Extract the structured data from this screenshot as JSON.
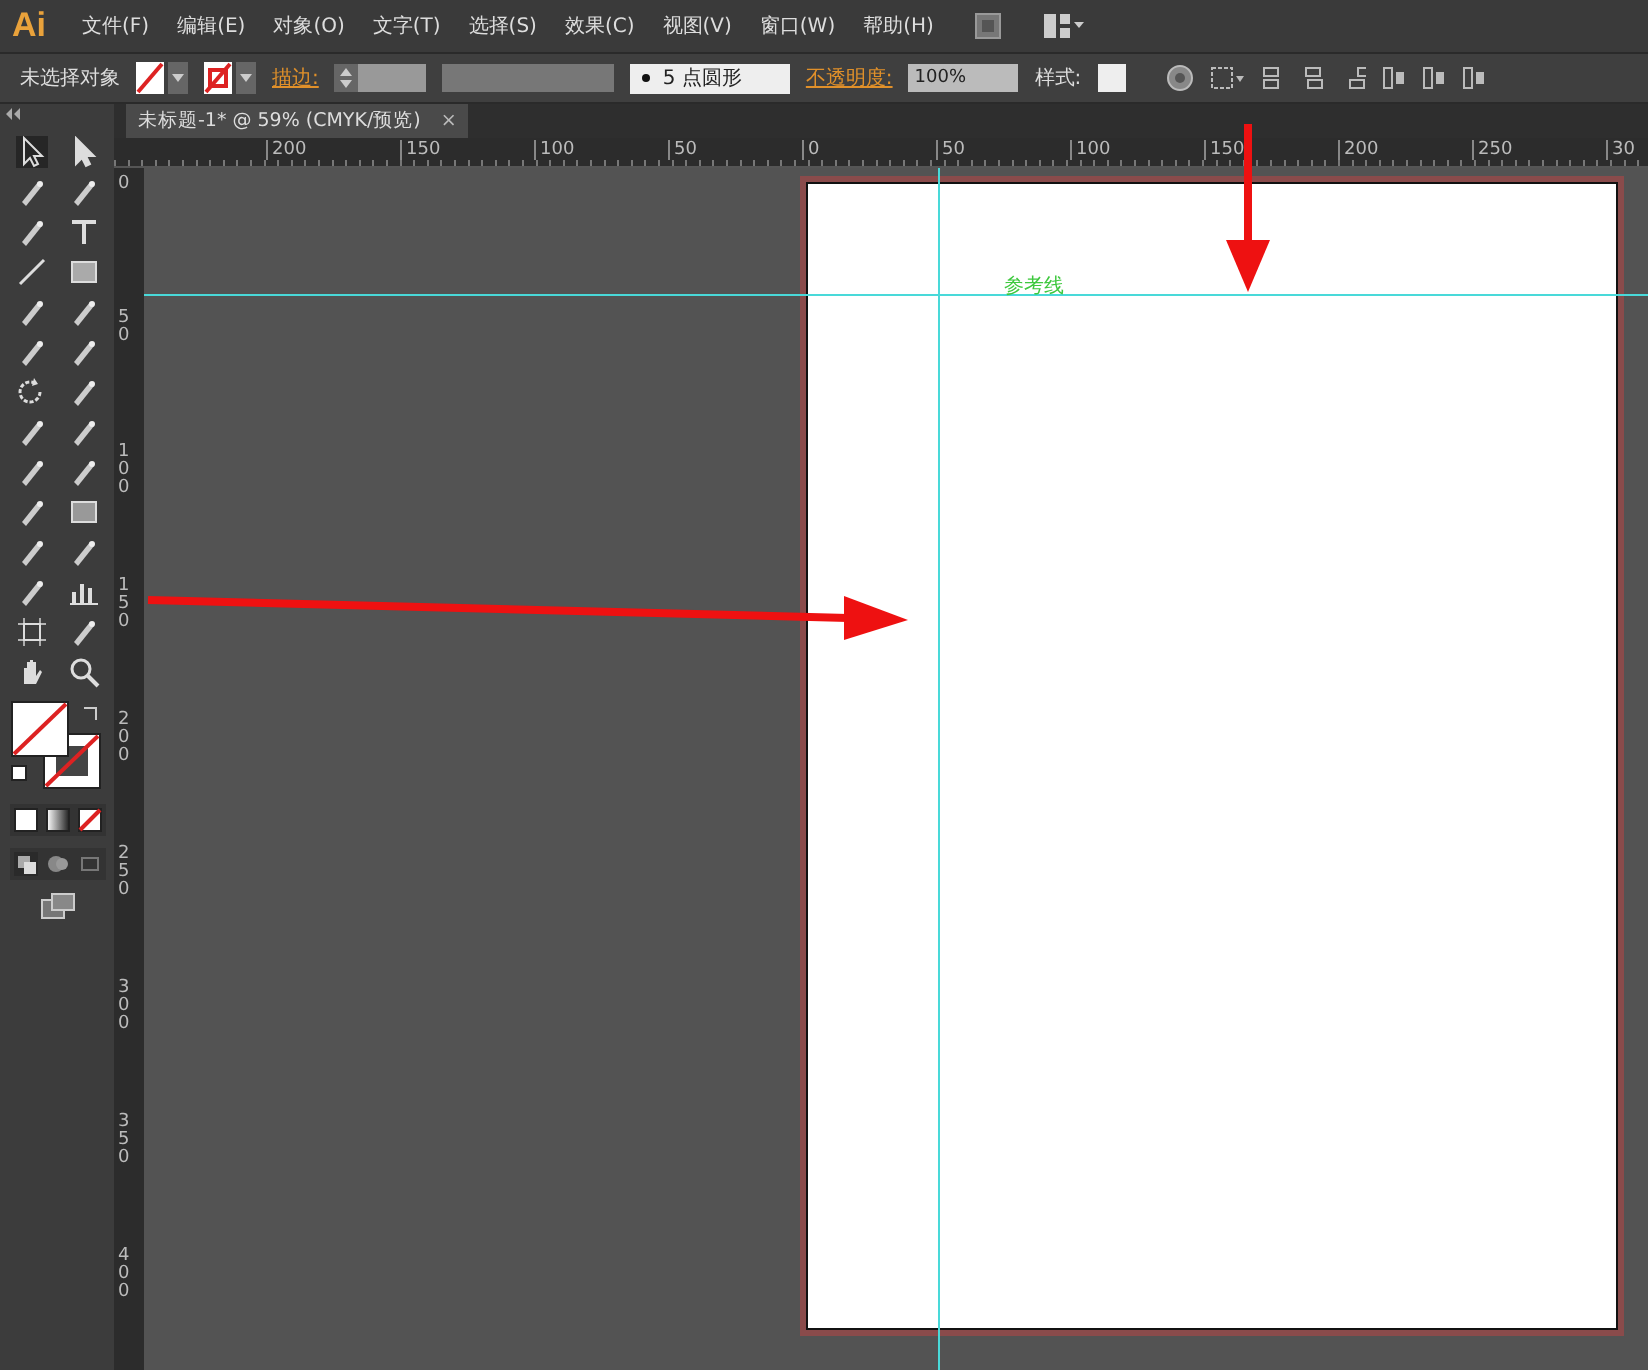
{
  "app": {
    "logo": "Ai"
  },
  "menu": [
    "文件(F)",
    "编辑(E)",
    "对象(O)",
    "文字(T)",
    "选择(S)",
    "效果(C)",
    "视图(V)",
    "窗口(W)",
    "帮助(H)"
  ],
  "control_bar": {
    "selection": "未选择对象",
    "stroke_label": "描边:",
    "brush": "5 点圆形",
    "opacity_label": "不透明度:",
    "opacity": "100%",
    "style_label": "样式:"
  },
  "document_tab": {
    "title": "未标题-1* @ 59% (CMYK/预览)",
    "close": "×"
  },
  "rulers": {
    "horizontal": [
      "200",
      "150",
      "100",
      "50",
      "0",
      "50",
      "100",
      "150",
      "200",
      "250",
      "30"
    ],
    "vertical": [
      "0",
      "50",
      "100",
      "150",
      "200",
      "250",
      "300",
      "350",
      "400"
    ]
  },
  "canvas": {
    "guide_label": "参考线"
  }
}
